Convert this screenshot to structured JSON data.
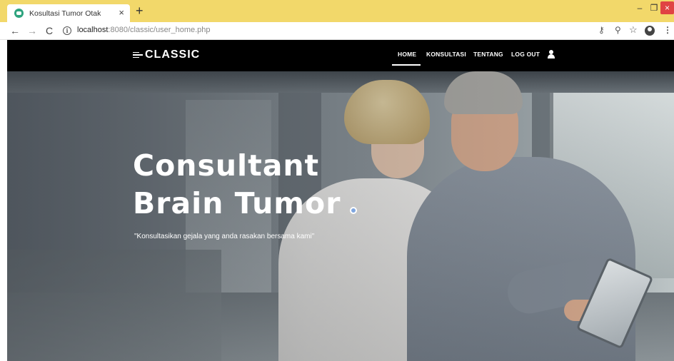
{
  "browser": {
    "tab_title": "Kosultasi Tumor Otak",
    "tab_close": "×",
    "new_tab": "+",
    "url_host": "localhost",
    "url_rest": ":8080/classic/user_home.php",
    "window_min": "–",
    "window_max": "❐",
    "window_close": "×"
  },
  "navbar": {
    "brand": "CLASSIC",
    "menu": {
      "home": "HOME",
      "konsultasi": "KONSULTASI",
      "tentang": "TENTANG",
      "logout": "LOG OUT"
    },
    "active_item": "HOME"
  },
  "hero": {
    "title_line1": "Consultant",
    "title_line2": "Brain Tumor",
    "subtitle": "\"Konsultasikan gejala yang anda rasakan bersama kami\""
  },
  "colors": {
    "tabstrip": "#f2d86a",
    "navbar": "#000000",
    "accent_dot": "#7fa6df",
    "favicon": "#2ea37e"
  },
  "icons": [
    "back-icon",
    "forward-icon",
    "reload-icon",
    "info-icon",
    "key-icon",
    "zoom-icon",
    "star-icon",
    "account-icon",
    "menu-icon",
    "user-icon"
  ]
}
